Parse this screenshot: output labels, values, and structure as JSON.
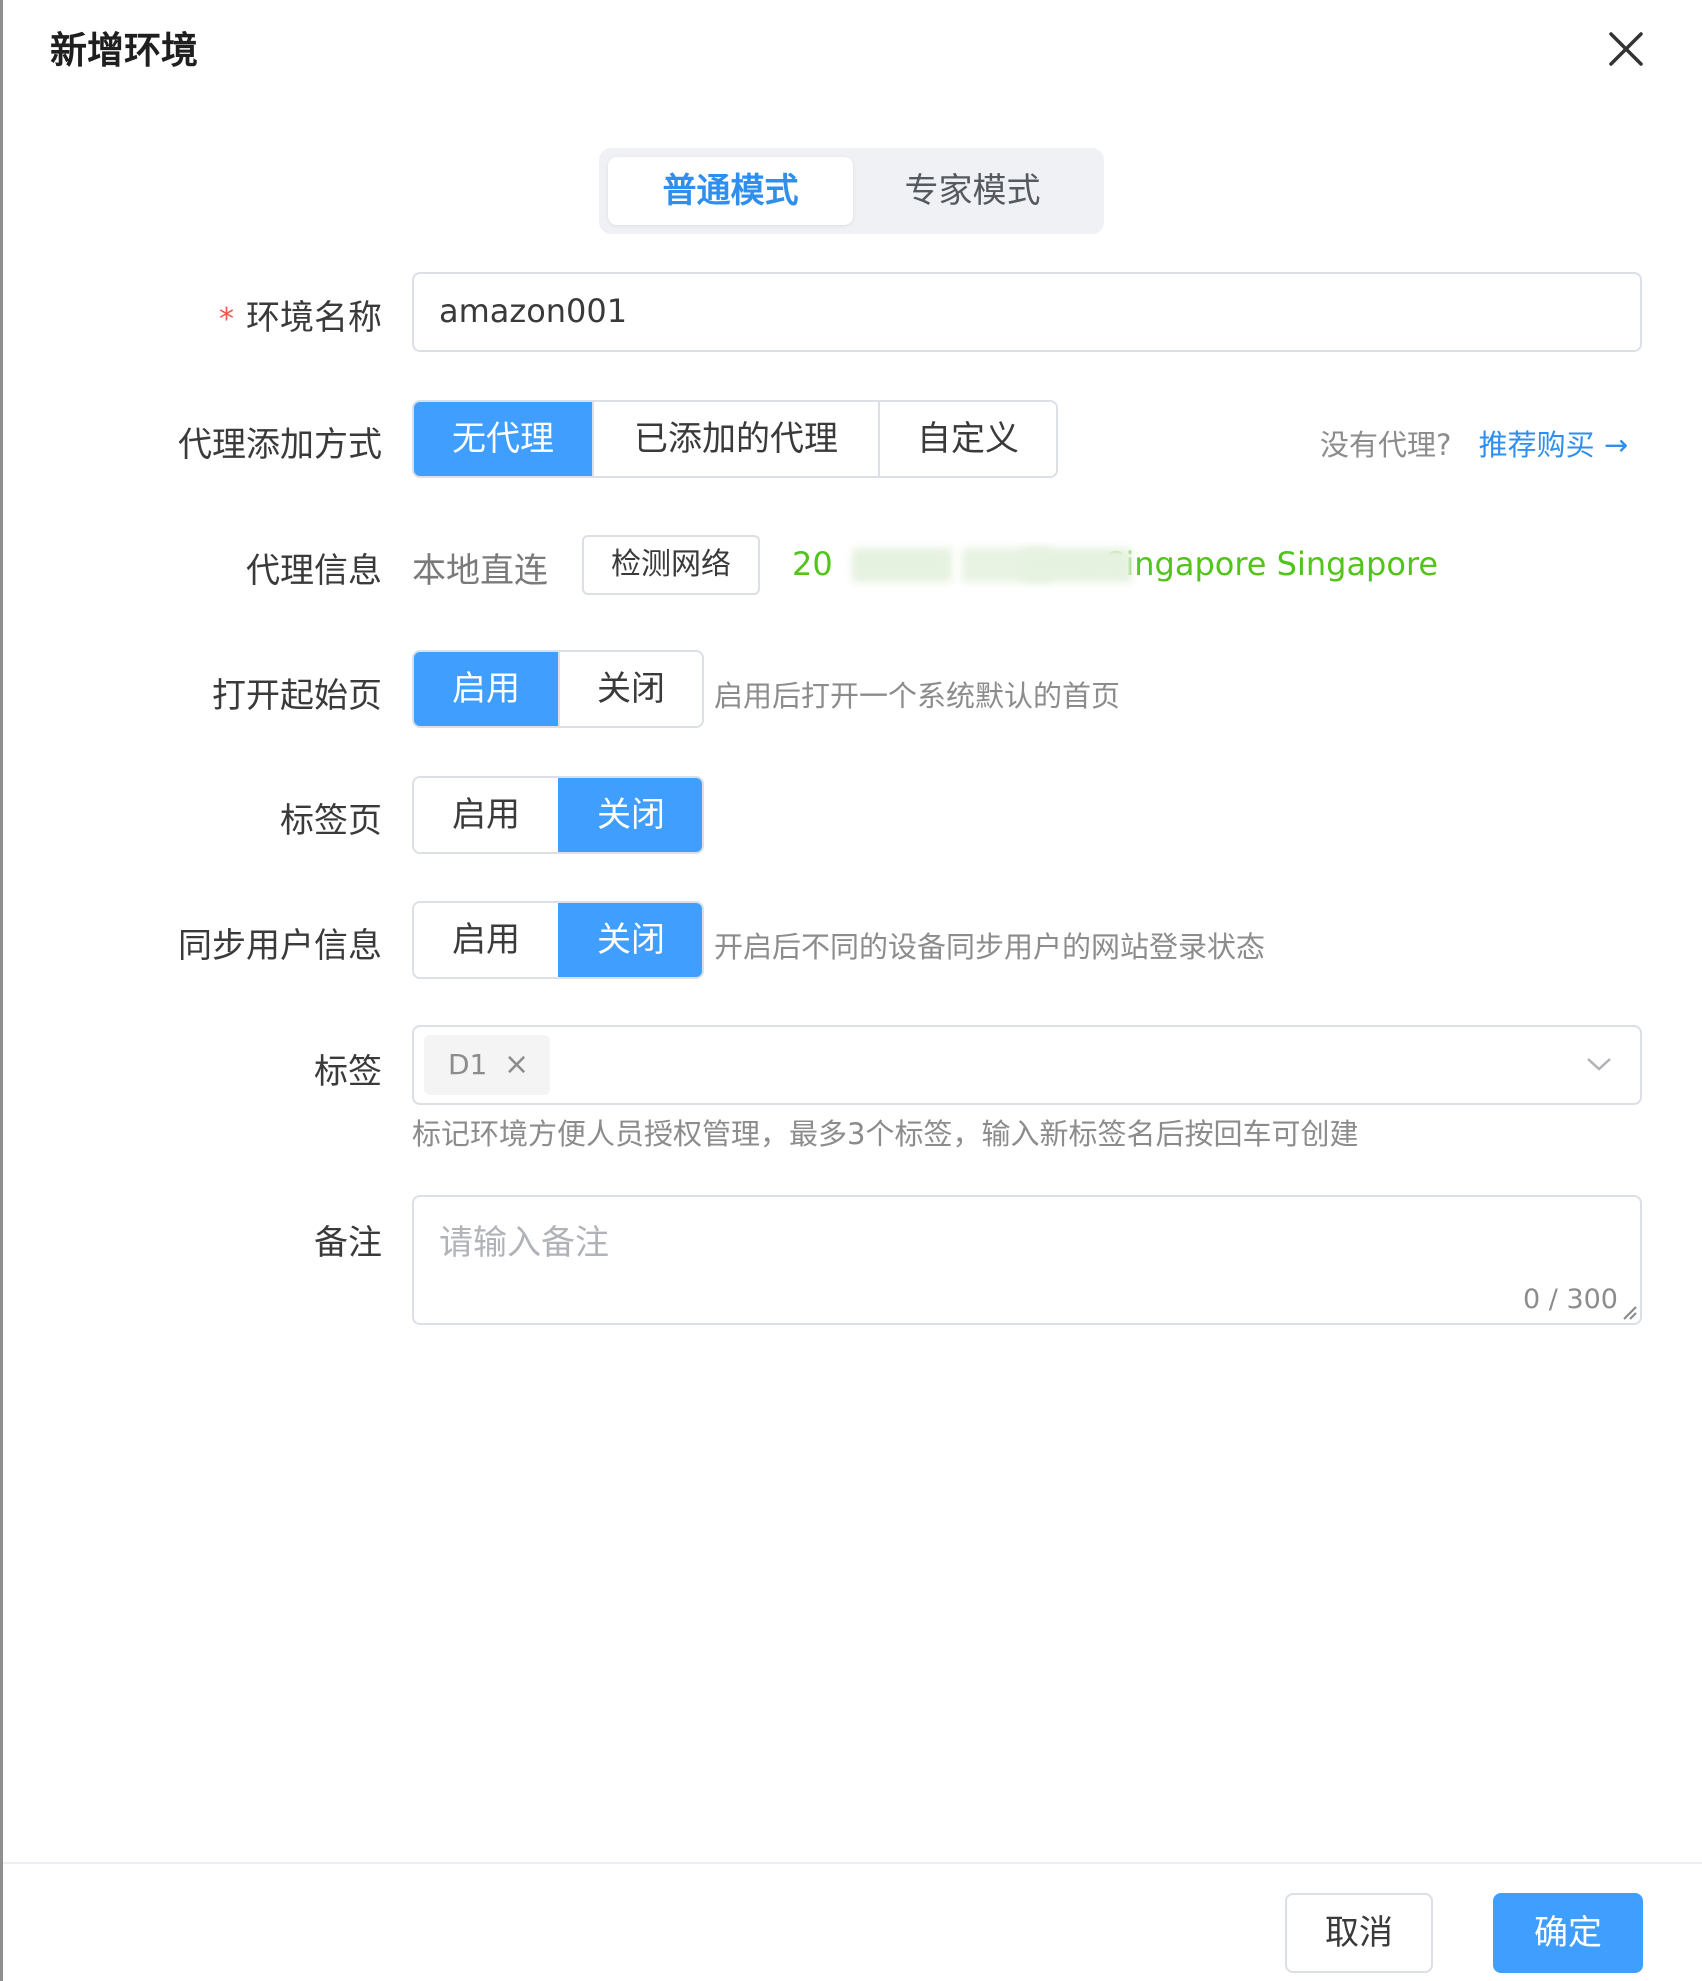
{
  "dialog": {
    "title": "新增环境"
  },
  "mode": {
    "normal": "普通模式",
    "expert": "专家模式"
  },
  "env_name": {
    "required_mark": "*",
    "label": "环境名称",
    "value": "amazon001"
  },
  "proxy_method": {
    "label": "代理添加方式",
    "options": [
      "无代理",
      "已添加的代理",
      "自定义"
    ],
    "selected": "无代理",
    "no_proxy_hint": "没有代理?",
    "buy_link": "推荐购买 →"
  },
  "proxy_info": {
    "label": "代理信息",
    "value": "本地直连",
    "check_button": "检测网络",
    "ip_prefix": "20",
    "ip_text": "re Singapore Singapore"
  },
  "start_page": {
    "label": "打开起始页",
    "on": "启用",
    "off": "关闭",
    "selected": "启用",
    "hint": "启用后打开一个系统默认的首页"
  },
  "tabs": {
    "label": "标签页",
    "on": "启用",
    "off": "关闭",
    "selected": "关闭"
  },
  "sync_user": {
    "label": "同步用户信息",
    "on": "启用",
    "off": "关闭",
    "selected": "关闭",
    "hint": "开启后不同的设备同步用户的网站登录状态"
  },
  "tags": {
    "label": "标签",
    "chip": "D1",
    "hint": "标记环境方便人员授权管理，最多3个标签，输入新标签名后按回车可创建"
  },
  "remark": {
    "label": "备注",
    "placeholder": "请输入备注",
    "counter": "0 / 300"
  },
  "footer": {
    "cancel": "取消",
    "confirm": "确定"
  },
  "colors": {
    "primary": "#409eff",
    "link": "#2f8fef",
    "success": "#52c41a",
    "required": "#f5544a"
  }
}
